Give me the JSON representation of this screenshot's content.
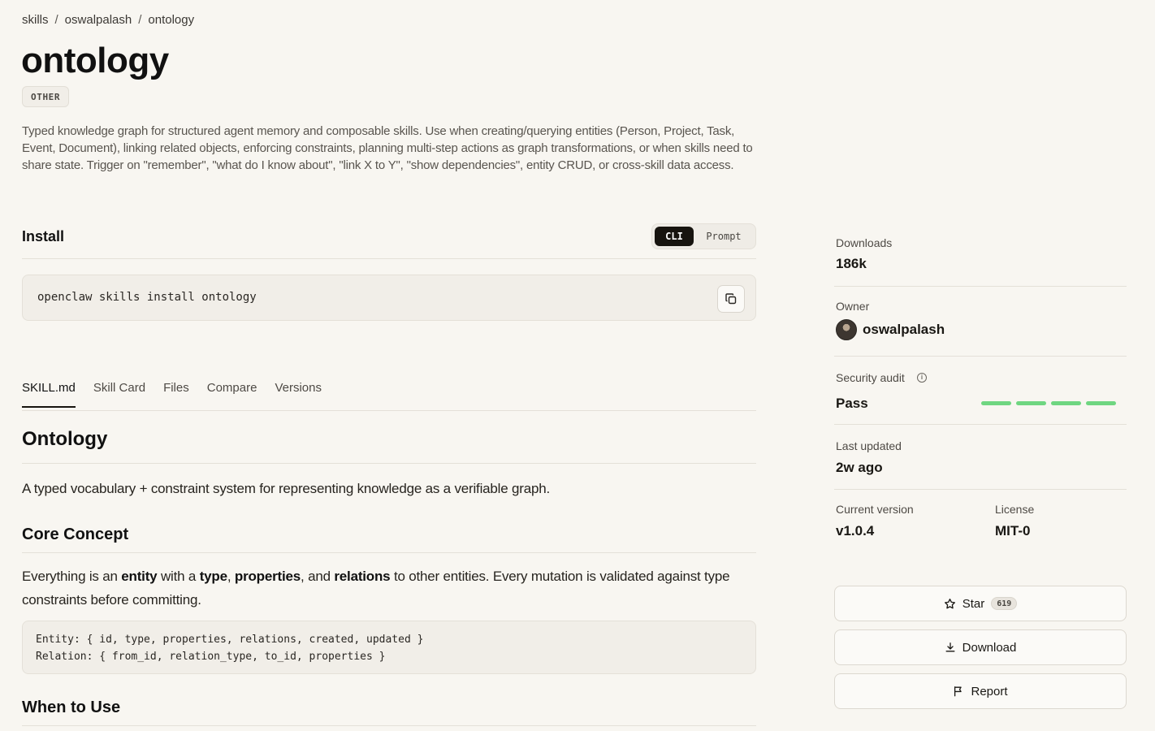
{
  "breadcrumb": {
    "root": "skills",
    "owner": "oswalpalash",
    "current": "ontology",
    "separator": "/"
  },
  "skill": {
    "title": "ontology",
    "category": "OTHER",
    "description": "Typed knowledge graph for structured agent memory and composable skills. Use when creating/querying entities (Person, Project, Task, Event, Document), linking related objects, enforcing constraints, planning multi-step actions as graph transformations, or when skills need to share state. Trigger on \"remember\", \"what do I know about\", \"link X to Y\", \"show dependencies\", entity CRUD, or cross-skill data access."
  },
  "install": {
    "title": "Install",
    "modes": {
      "cli": "CLI",
      "prompt": "Prompt"
    },
    "active_mode": "CLI",
    "command": "openclaw skills install ontology"
  },
  "tabs": [
    {
      "label": "SKILL.md",
      "active": true
    },
    {
      "label": "Skill Card",
      "active": false
    },
    {
      "label": "Files",
      "active": false
    },
    {
      "label": "Compare",
      "active": false
    },
    {
      "label": "Versions",
      "active": false
    }
  ],
  "doc": {
    "heading": "Ontology",
    "intro": "A typed vocabulary + constraint system for representing knowledge as a verifiable graph.",
    "core_heading": "Core Concept",
    "core": {
      "t1": "Everything is an ",
      "b1": "entity",
      "t2": " with a ",
      "b2": "type",
      "t3": ", ",
      "b3": "properties",
      "t4": ", and ",
      "b4": "relations",
      "t5": " to other entities. Every mutation is validated against type constraints before committing."
    },
    "code_lines": [
      "Entity: { id, type, properties, relations, created, updated }",
      "Relation: { from_id, relation_type, to_id, properties }"
    ],
    "when_heading": "When to Use"
  },
  "sidebar": {
    "downloads_label": "Downloads",
    "downloads_value": "186k",
    "owner_label": "Owner",
    "owner_value": "oswalpalash",
    "audit_label": "Security audit",
    "audit_value": "Pass",
    "audit_segments_passed": 4,
    "updated_label": "Last updated",
    "updated_value": "2w ago",
    "version_label": "Current version",
    "version_value": "v1.0.4",
    "license_label": "License",
    "license_value": "MIT-0",
    "star_label": "Star",
    "star_count": "619",
    "download_label": "Download",
    "report_label": "Report"
  },
  "colors": {
    "background": "#f8f6f1",
    "audit_pass": "#6fd681",
    "active_toggle": "#17140f"
  }
}
